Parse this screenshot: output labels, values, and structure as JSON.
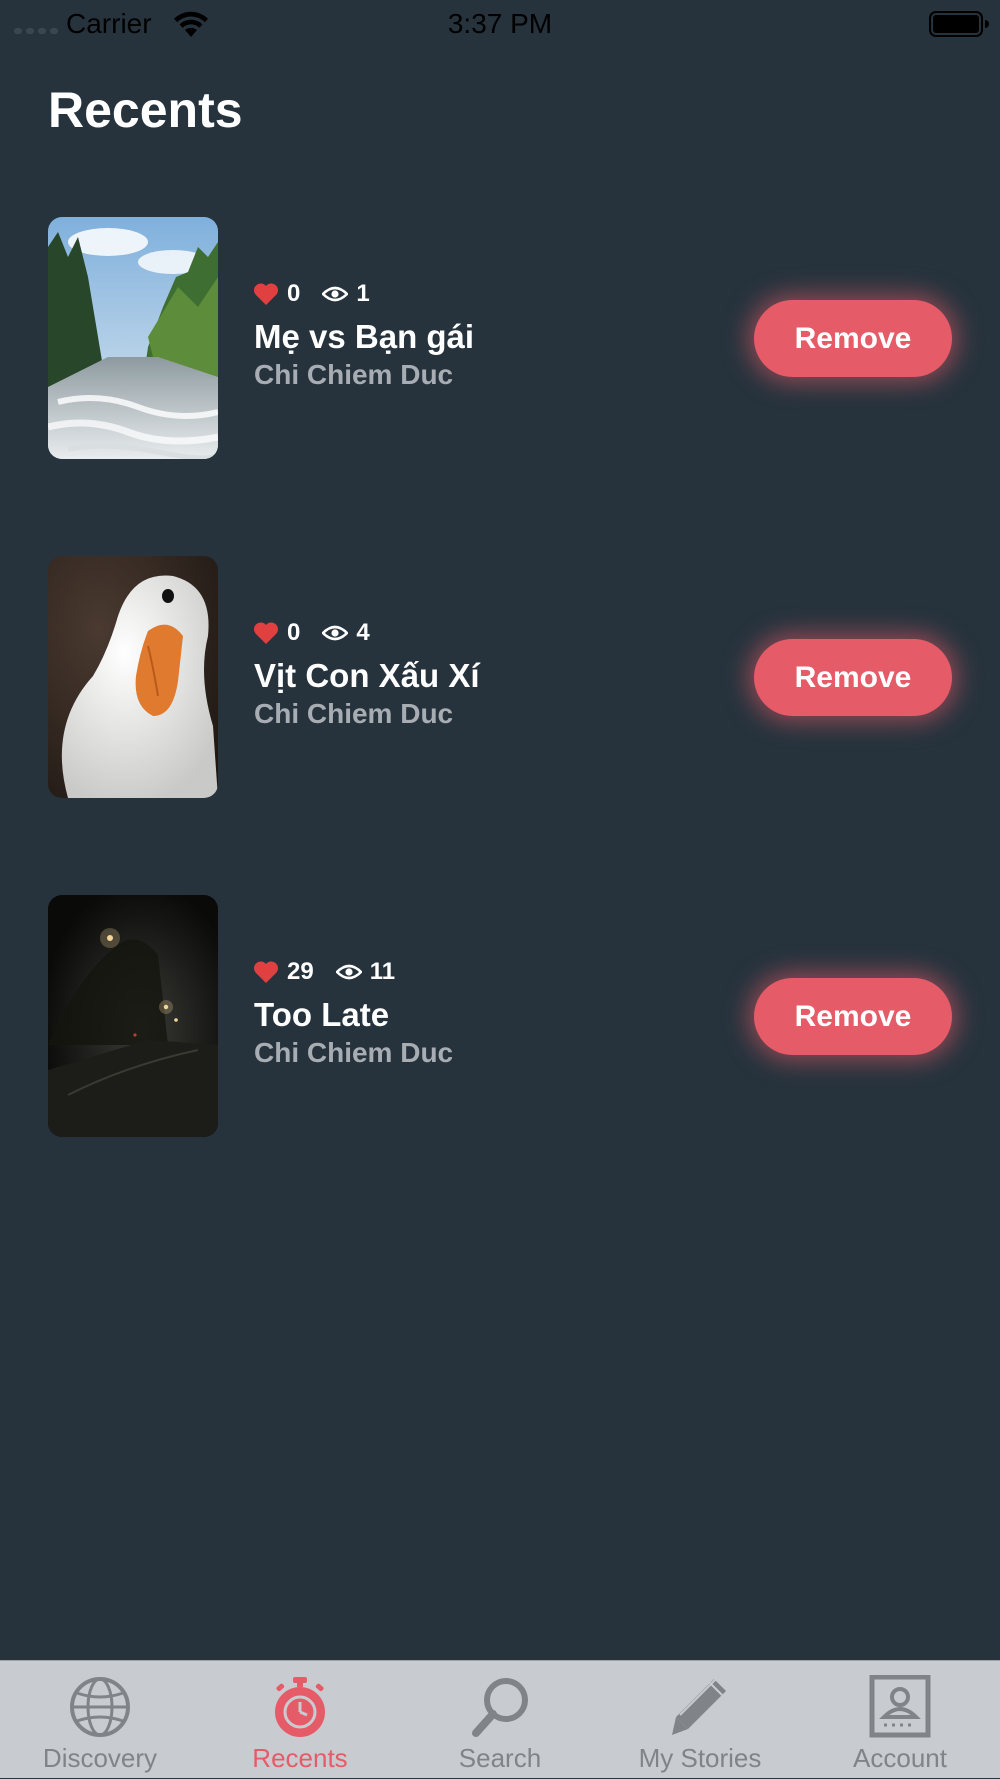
{
  "status_bar": {
    "carrier": "Carrier",
    "time": "3:37 PM"
  },
  "page": {
    "title": "Recents"
  },
  "stories": [
    {
      "likes": "0",
      "views": "1",
      "title": "Mẹ vs Bạn gái",
      "author": "Chi Chiem Duc",
      "thumbnail": "river-forest-image",
      "remove_label": "Remove"
    },
    {
      "likes": "0",
      "views": "4",
      "title": "Vịt Con Xấu Xí",
      "author": "Chi Chiem Duc",
      "thumbnail": "white-duck-image",
      "remove_label": "Remove"
    },
    {
      "likes": "29",
      "views": "11",
      "title": "Too Late",
      "author": "Chi Chiem Duc",
      "thumbnail": "foggy-night-street-image",
      "remove_label": "Remove"
    }
  ],
  "tab_bar": {
    "active": "Recents",
    "tabs": [
      {
        "label": "Discovery",
        "icon": "globe-icon"
      },
      {
        "label": "Recents",
        "icon": "stopwatch-icon"
      },
      {
        "label": "Search",
        "icon": "magnifier-icon"
      },
      {
        "label": "My Stories",
        "icon": "pencil-icon"
      },
      {
        "label": "Account",
        "icon": "account-card-icon"
      }
    ]
  },
  "colors": {
    "background": "#26333d",
    "accent": "#e55b68",
    "heart": "#e0403f",
    "author_text": "#a8adb3",
    "tab_bar": "#c8ccd0",
    "tab_inactive": "#808489"
  }
}
